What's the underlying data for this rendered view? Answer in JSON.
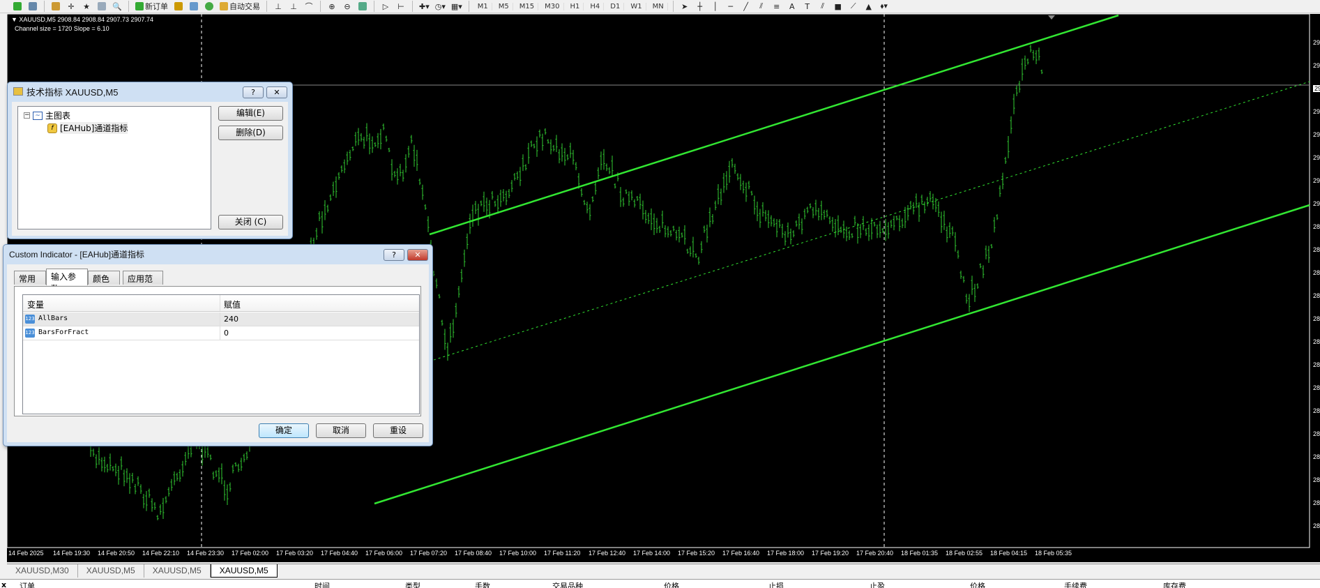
{
  "toolbar": {
    "new_order": "新订单",
    "auto_trading": "自动交易",
    "timeframes": [
      "M1",
      "M5",
      "M15",
      "M30",
      "H1",
      "H4",
      "D1",
      "W1",
      "MN"
    ]
  },
  "chart": {
    "symbol_line": "▼ XAUUSD,M5  2908.84 2908.84 2907.73 2907.74",
    "indicator_line": "Channel size = 1720 Slope = 6.10",
    "price_labels": [
      "29",
      "29",
      "29",
      "29",
      "29",
      "29",
      "29",
      "29",
      "28",
      "28",
      "28",
      "28",
      "28",
      "28",
      "28",
      "28",
      "28",
      "28",
      "28",
      "28",
      "28",
      "28"
    ],
    "time_labels": [
      "14 Feb 2025",
      "14 Feb 19:30",
      "14 Feb 20:50",
      "14 Feb 22:10",
      "14 Feb 23:30",
      "17 Feb 02:00",
      "17 Feb 03:20",
      "17 Feb 04:40",
      "17 Feb 06:00",
      "17 Feb 07:20",
      "17 Feb 08:40",
      "17 Feb 10:00",
      "17 Feb 11:20",
      "17 Feb 12:40",
      "17 Feb 14:00",
      "17 Feb 15:20",
      "17 Feb 16:40",
      "17 Feb 18:00",
      "17 Feb 19:20",
      "17 Feb 20:40",
      "18 Feb 01:35",
      "18 Feb 02:55",
      "18 Feb 04:15",
      "18 Feb 05:35"
    ],
    "colors": {
      "bars": "#32cd32",
      "channel": "#32e632",
      "background": "#000000"
    }
  },
  "tabs": [
    "XAUUSD,M30",
    "XAUUSD,M5",
    "XAUUSD,M5",
    "XAUUSD,M5"
  ],
  "terminal": {
    "columns": [
      "订单",
      "时间",
      "类型",
      "手数",
      "交易品种",
      "价格",
      "止损",
      "止盈",
      "价格",
      "手续费",
      "库存费"
    ]
  },
  "indicators_dialog": {
    "title": "技术指标 XAUUSD,M5",
    "help": "?",
    "close": "✕",
    "tree_root": "主图表",
    "tree_child": "[EAHub]通道指标",
    "edit": "编辑(E)",
    "delete": "删除(D)",
    "close_btn": "关闭 (C)"
  },
  "custom_dialog": {
    "title": "Custom Indicator - [EAHub]通道指标",
    "help": "?",
    "close": "✕",
    "tabs": [
      "常用",
      "输入参数",
      "颜色",
      "应用范围"
    ],
    "headers": [
      "变量",
      "赋值"
    ],
    "rows": [
      {
        "name": "AllBars",
        "value": "240"
      },
      {
        "name": "BarsForFract",
        "value": "0"
      }
    ],
    "ok": "确定",
    "cancel": "取消",
    "reset": "重设"
  }
}
